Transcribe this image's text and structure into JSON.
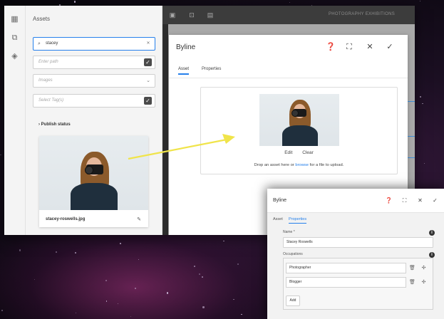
{
  "rail": {
    "icons": [
      "panels-icon",
      "assets-icon",
      "layers-icon"
    ]
  },
  "assets_panel": {
    "title": "Assets",
    "search": {
      "value": "stacey",
      "placeholder": ""
    },
    "path": {
      "placeholder": "Enter path"
    },
    "type": {
      "value": "Images"
    },
    "tags": {
      "placeholder": "Select Tag(s)"
    },
    "publish_status": "Publish status",
    "card": {
      "filename": "stacey-roswells.jpg"
    }
  },
  "editor": {
    "toolbar_title": "PHOTOGRAPHY EXHIBITIONS",
    "dialog": {
      "title": "Byline",
      "tabs": [
        "Asset",
        "Properties"
      ],
      "actions": {
        "edit": "Edit",
        "clear": "Clear"
      },
      "drop_text_before": "Drop an asset here or ",
      "drop_link": "browse",
      "drop_text_after": " for a file to upload."
    }
  },
  "overlay": {
    "title": "Byline",
    "tabs": [
      "Asset",
      "Properties"
    ],
    "name_label": "Name *",
    "name_value": "Stacey Roswells",
    "occupations_label": "Occupations",
    "occupations": [
      "Photographer",
      "Blogger"
    ],
    "add_label": "Add"
  },
  "colors": {
    "accent": "#2680eb",
    "arrow": "#f0e44a",
    "topbar": "#3c3c3c"
  }
}
